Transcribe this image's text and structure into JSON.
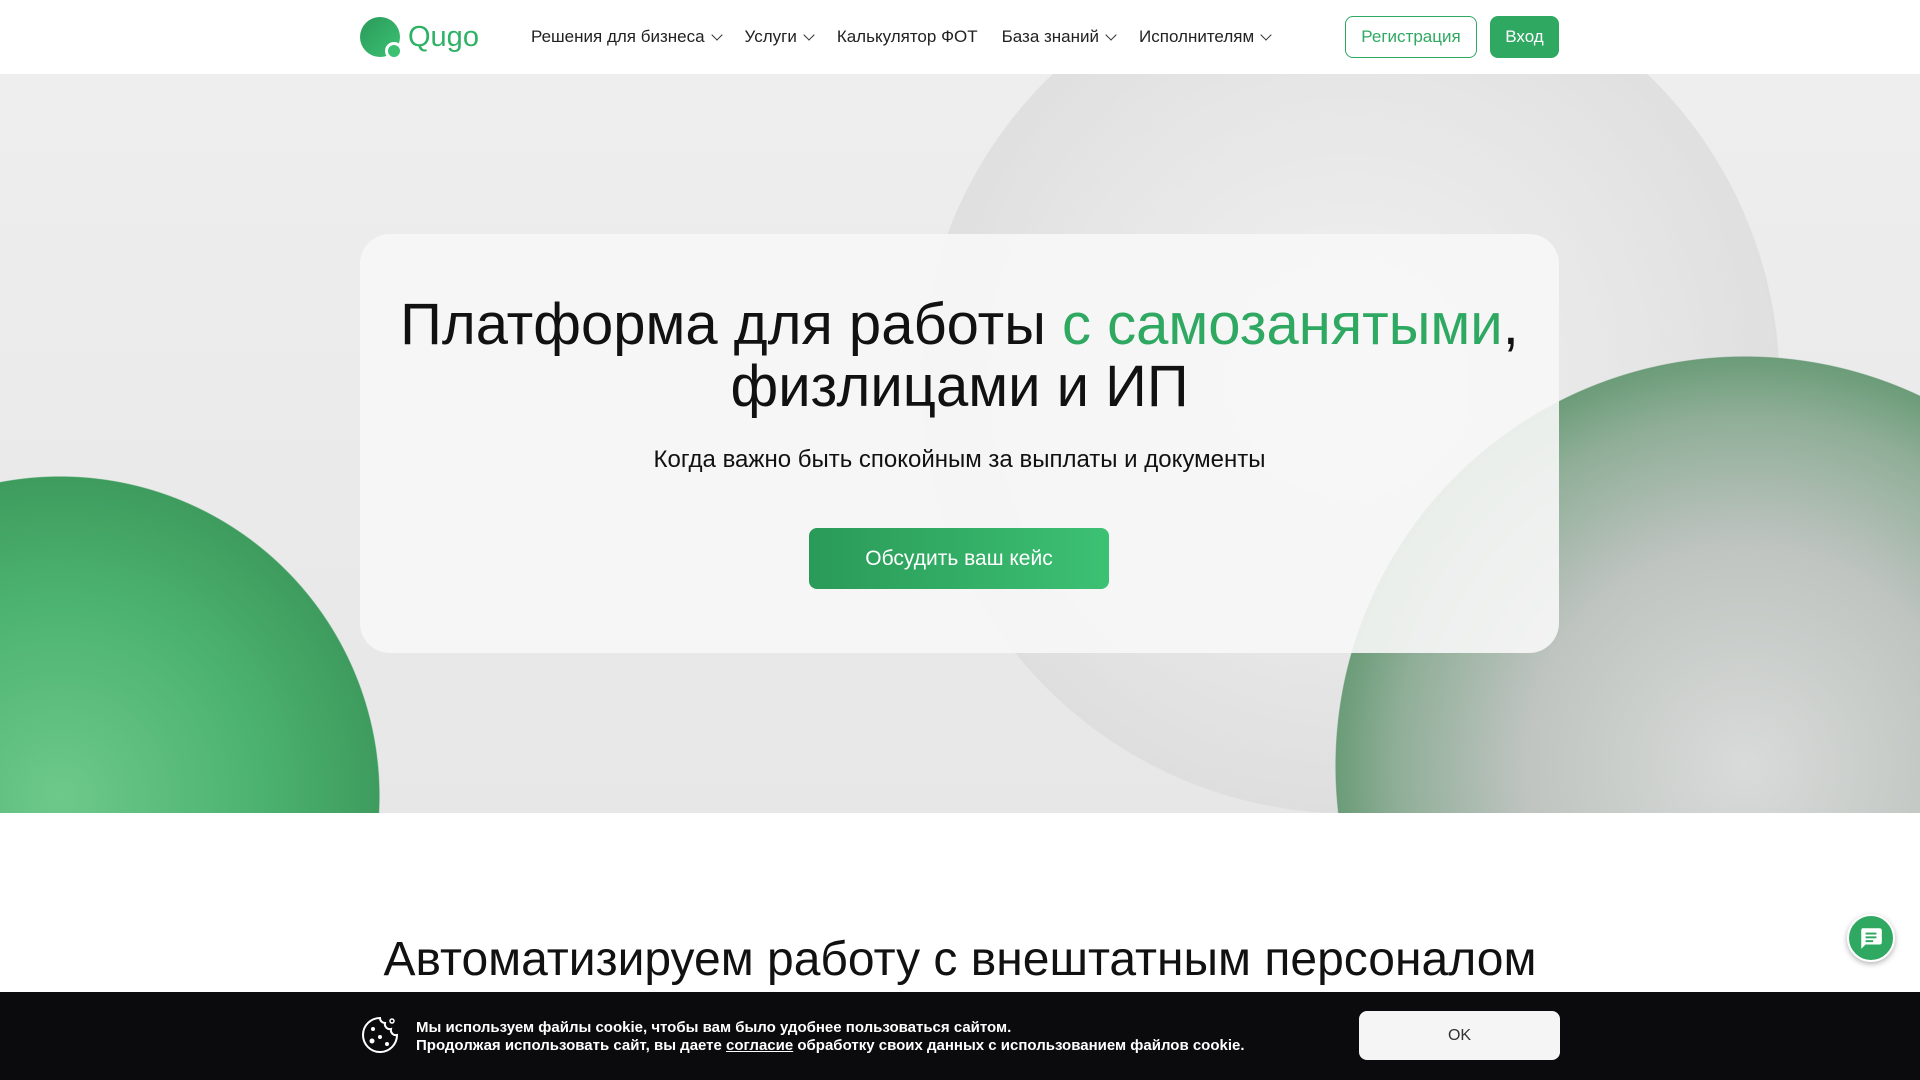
{
  "brand": {
    "name": "Qugo",
    "accent": "#2fa862"
  },
  "nav": {
    "items": [
      {
        "label": "Решения для бизнеса",
        "dropdown": true
      },
      {
        "label": "Услуги",
        "dropdown": true
      },
      {
        "label": "Калькулятор ФОТ",
        "dropdown": false
      },
      {
        "label": "База знаний",
        "dropdown": true
      },
      {
        "label": "Исполнителям",
        "dropdown": true
      }
    ],
    "register": "Регистрация",
    "login": "Вход"
  },
  "hero": {
    "title_start": "Платформа для работы ",
    "title_accent": "с самозанятыми",
    "title_end": ",",
    "title_line2": "физлицами и ИП",
    "subtitle": "Когда важно быть спокойным за выплаты и документы",
    "cta": "Обсудить ваш кейс"
  },
  "section": {
    "title": "Автоматизируем работу с внештатным персоналом"
  },
  "cookie": {
    "line1": "Мы используем файлы cookie, чтобы вам было удобнее пользоваться сайтом.",
    "line2_start": "Продолжая использовать сайт, вы даете ",
    "line2_link": "согласие",
    "line2_end": " обработку своих данных с использованием файлов cookie.",
    "ok": "OK"
  }
}
